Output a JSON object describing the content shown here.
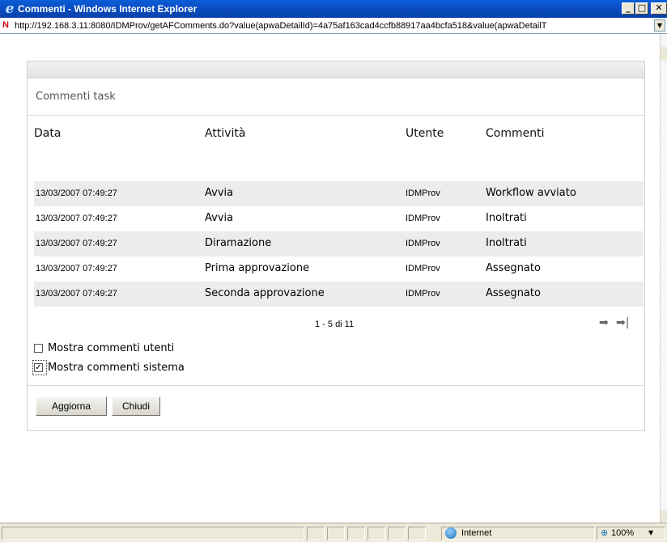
{
  "window": {
    "title": "Commenti - Windows Internet Explorer",
    "minimize": "_",
    "maximize": "□",
    "close": "✕"
  },
  "address": {
    "url": "http://192.168.3.11:8080/IDMProv/getAFComments.do?value(apwaDetailId)=4a75af163cad4ccfb88917aa4bcfa518&value(apwaDetailT"
  },
  "panel": {
    "title": "Commenti task",
    "columns": [
      "Data",
      "Attività",
      "Utente",
      "Commenti"
    ],
    "rows": [
      {
        "date": "13/03/2007 07:49:27",
        "activity": "Avvia",
        "user": "IDMProv",
        "comment": "Workflow avviato"
      },
      {
        "date": "13/03/2007 07:49:27",
        "activity": "Avvia",
        "user": "IDMProv",
        "comment": "Inoltrati"
      },
      {
        "date": "13/03/2007 07:49:27",
        "activity": "Diramazione",
        "user": "IDMProv",
        "comment": "Inoltrati"
      },
      {
        "date": "13/03/2007 07:49:27",
        "activity": "Prima approvazione",
        "user": "IDMProv",
        "comment": "Assegnato"
      },
      {
        "date": "13/03/2007 07:49:27",
        "activity": "Seconda approvazione",
        "user": "IDMProv",
        "comment": "Assegnato"
      }
    ],
    "pager": {
      "text": "1 - 5 di 11",
      "next_icon": "➡",
      "last_icon": "➡|"
    },
    "checkboxes": [
      {
        "label": "Mostra commenti utenti",
        "checked": false
      },
      {
        "label": "Mostra commenti sistema",
        "checked": true
      }
    ],
    "buttons": {
      "refresh": "Aggiorna",
      "close": "Chiudi"
    }
  },
  "status": {
    "zone": "Internet",
    "zoom": "100%"
  }
}
